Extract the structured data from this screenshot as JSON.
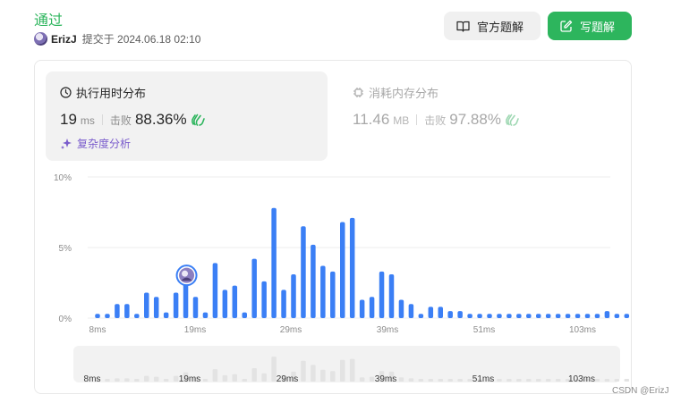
{
  "header": {
    "status": "通过",
    "user": "ErizJ",
    "submitted": "提交于 2024.06.18 02:10",
    "official_solution": "官方题解",
    "write_solution": "写题解"
  },
  "cards": {
    "runtime": {
      "title": "执行用时分布",
      "value": "19",
      "unit": "ms",
      "beat_label": "击败",
      "beat": "88.36%"
    },
    "memory": {
      "title": "消耗内存分布",
      "value": "11.46",
      "unit": "MB",
      "beat_label": "击败",
      "beat": "97.88%"
    },
    "analysis": "复杂度分析"
  },
  "chart_data": {
    "type": "bar",
    "ylim": [
      0,
      10
    ],
    "yticks": [
      "10%",
      "5%",
      "0%"
    ],
    "xticks": [
      "8ms",
      "19ms",
      "29ms",
      "39ms",
      "51ms",
      "103ms"
    ],
    "values": [
      0.3,
      0.3,
      1.0,
      1.0,
      0.3,
      1.8,
      1.5,
      0.4,
      1.8,
      2.9,
      1.5,
      0.4,
      3.9,
      2.0,
      2.3,
      0.4,
      4.2,
      2.6,
      7.8,
      2.0,
      3.1,
      6.5,
      5.2,
      3.7,
      3.3,
      6.8,
      7.1,
      1.3,
      1.5,
      3.3,
      3.1,
      1.3,
      1.0,
      0.3,
      0.8,
      0.8,
      0.5,
      0.5,
      0.3,
      0.3,
      0.3,
      0.3,
      0.3,
      0.3,
      0.3,
      0.3,
      0.3,
      0.3,
      0.3,
      0.3,
      0.3,
      0.3,
      0.5,
      0.3,
      0.3
    ],
    "user_marker_index": 9,
    "grid": true
  },
  "watermark": "CSDN @ErizJ"
}
